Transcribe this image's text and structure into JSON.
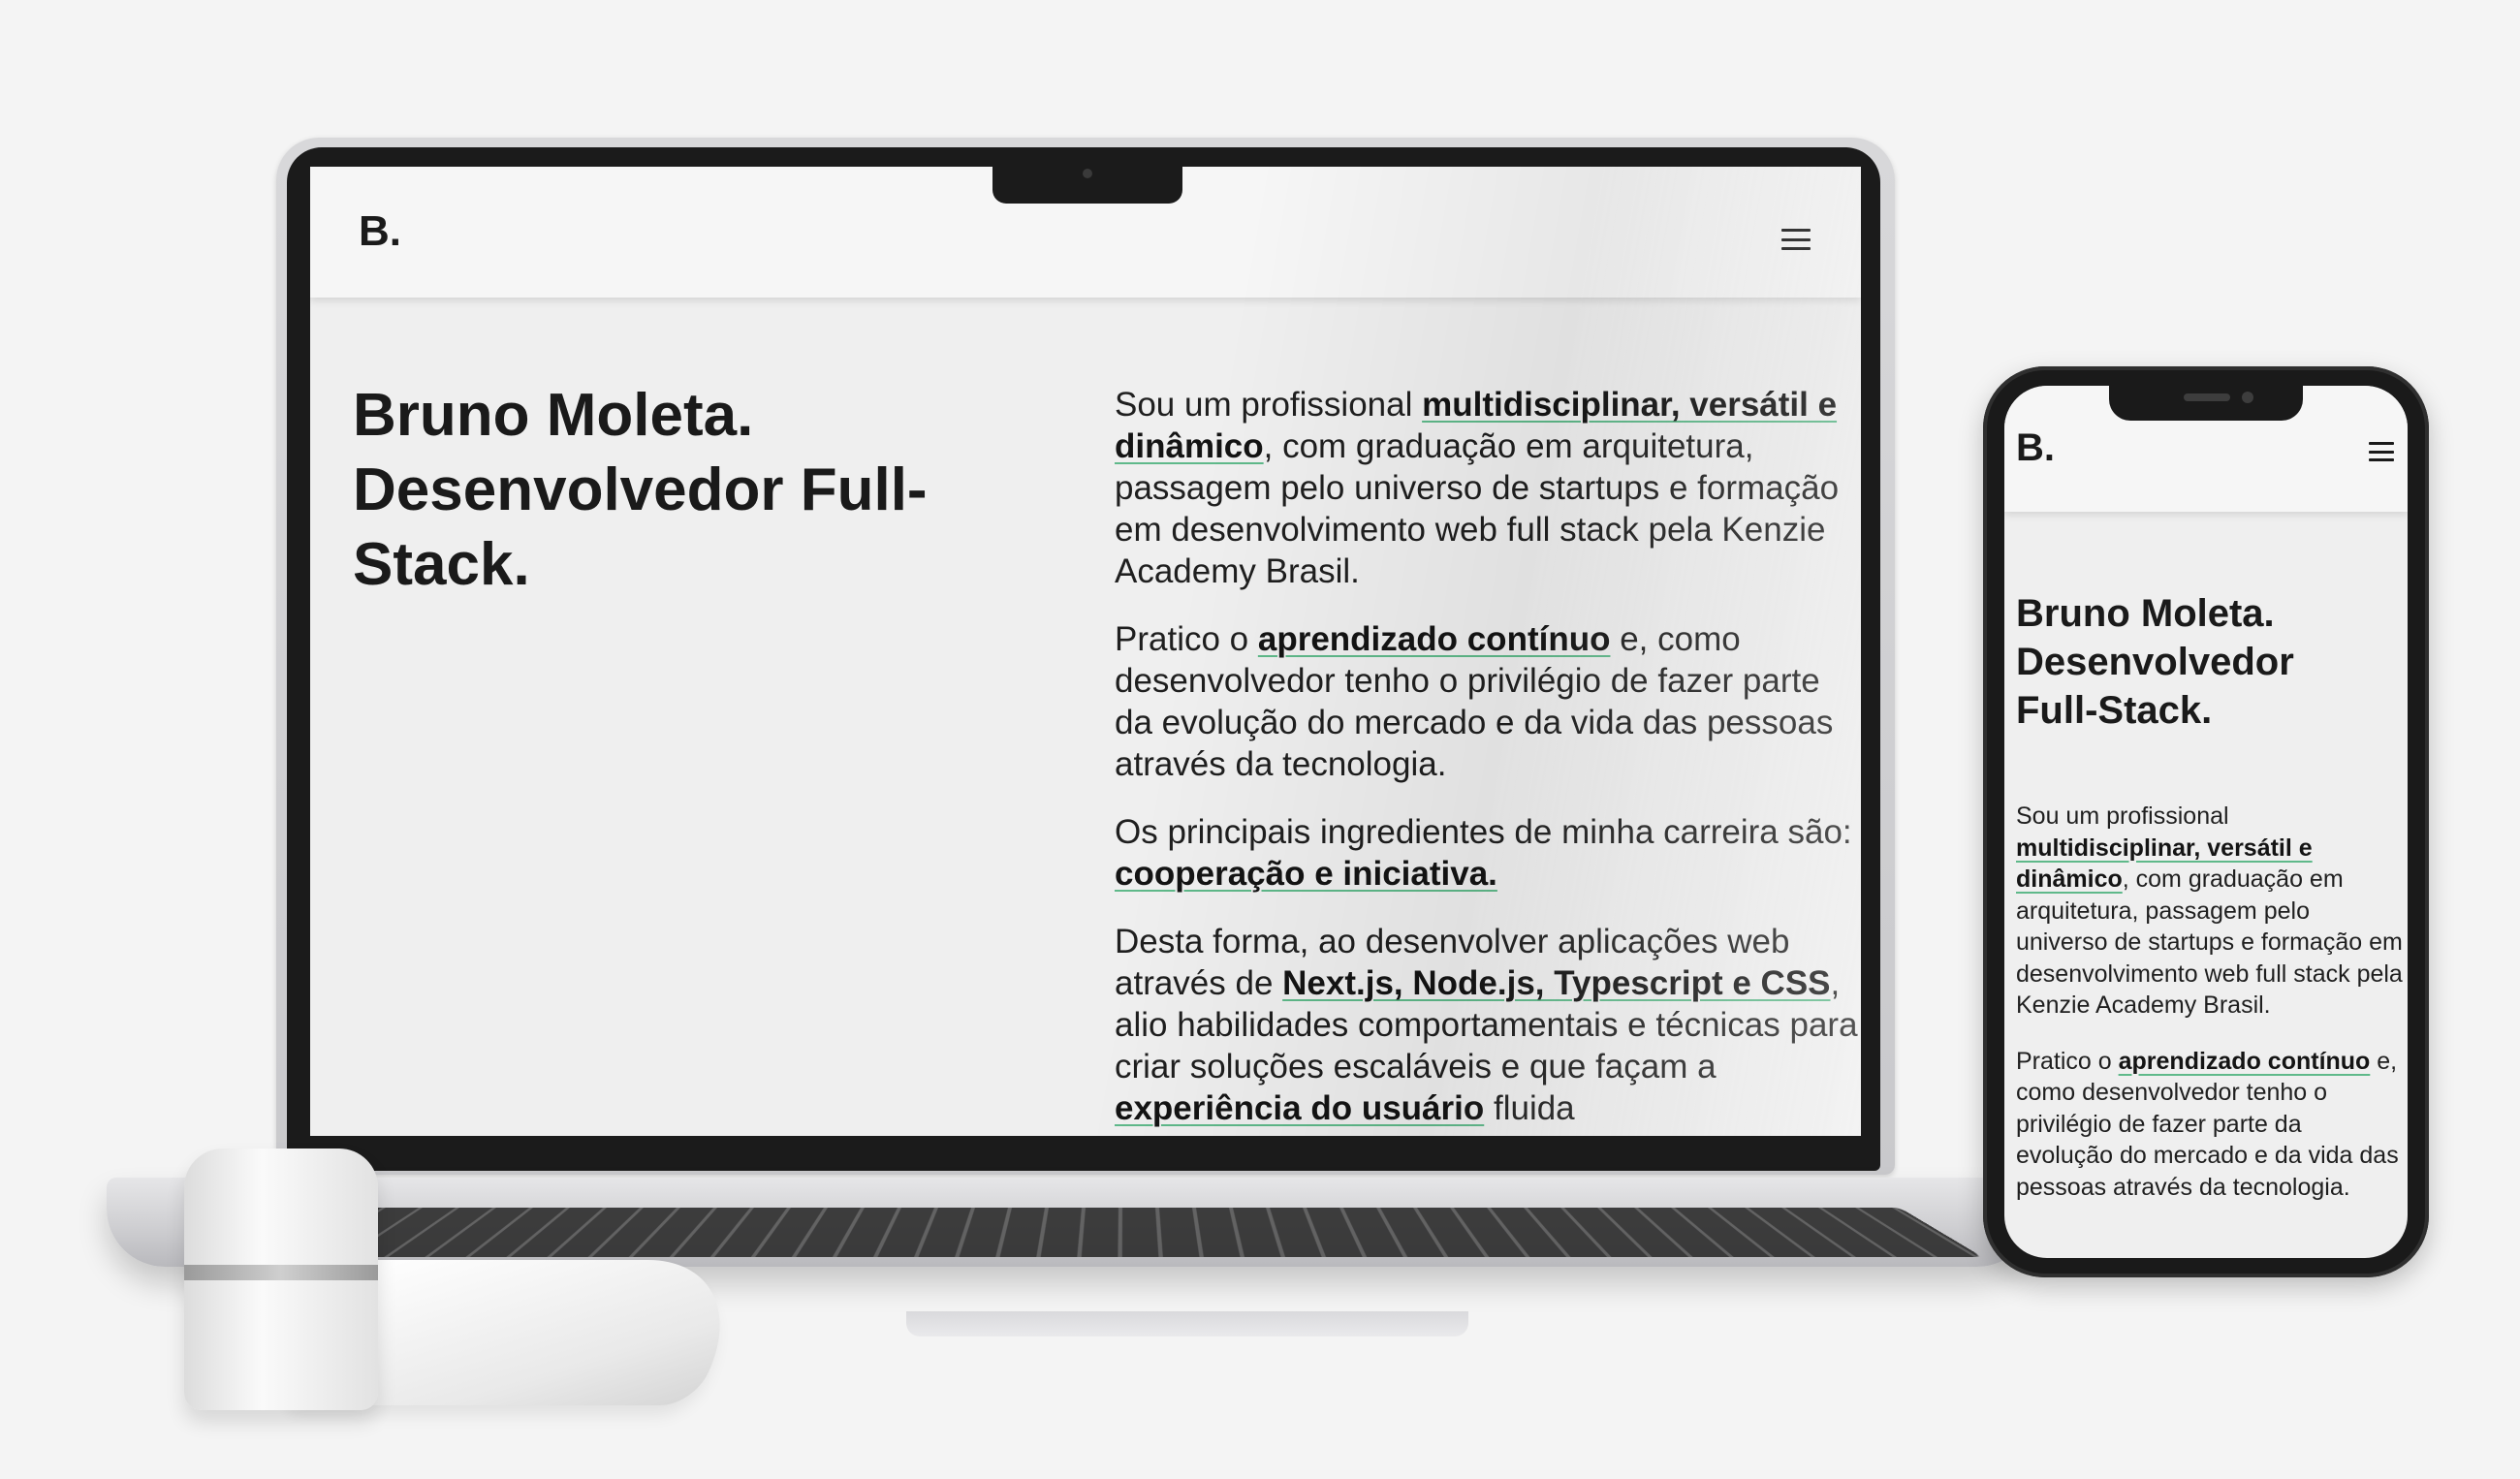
{
  "site": {
    "logo": "B.",
    "menu_icon": "hamburger-menu-icon",
    "hero_title_lines": [
      "Bruno Moleta.",
      "Desenvolvedor Full-",
      "Stack."
    ],
    "hero_title_mobile_lines": [
      "Bruno Moleta.",
      "Desenvolvedor",
      "Full-Stack."
    ],
    "bio": {
      "p1": {
        "t1": "Sou um profissional ",
        "h1": "multidisciplinar, versátil e dinâmico",
        "t2": ", com graduação em arquitetura, passagem pelo universo de startups e formação em desenvolvimento web full stack pela Kenzie Academy Brasil."
      },
      "p2": {
        "t1": "Pratico o ",
        "h1": "aprendizado contínuo",
        "t2": " e, como desenvolvedor tenho o privilégio de fazer parte da evolução do mercado e da vida das pessoas através da tecnologia."
      },
      "p3": {
        "t1": "Os principais ingredientes de minha carreira são: ",
        "h1": "cooperação e iniciativa."
      },
      "p4": {
        "t1": "Desta forma, ao desenvolver aplicações web através de ",
        "h1": "Next.js, Node.js, Typescript e CSS",
        "t2": ", alio habilidades comportamentais e técnicas para criar soluções escaláveis e que façam a ",
        "h2": "experiência do usuário",
        "t3": " fluida"
      }
    }
  },
  "colors": {
    "highlight_underline": "#5fb98a",
    "text": "#1a1a1a",
    "page_background": "#efefef"
  }
}
